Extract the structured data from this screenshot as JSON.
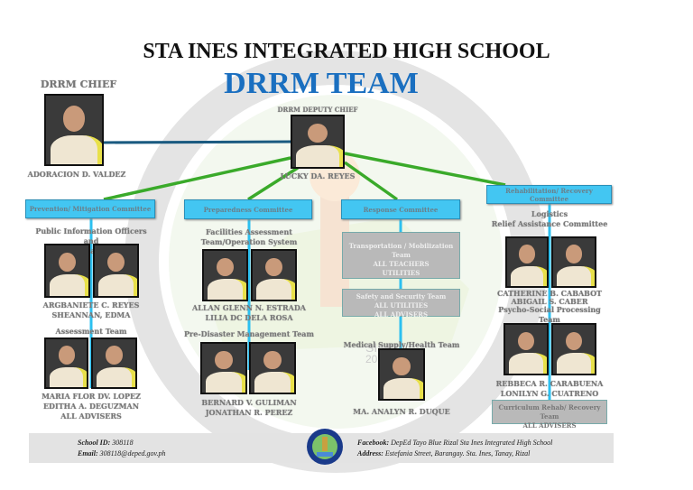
{
  "header": {
    "school": "STA INES INTEGRATED HIGH SCHOOL",
    "team": "DRRM TEAM"
  },
  "chief": {
    "label": "DRRM CHIEF",
    "name": "ADORACION D. VALDEZ"
  },
  "deputy": {
    "label": "DRRM DEPUTY CHIEF",
    "name": "LUCKY DA. REYES"
  },
  "committees": {
    "prevention": {
      "label": "Prevention/ Mitigation Committee",
      "team1": {
        "title1": "Public Information Officers and",
        "title2": "Communication Team",
        "name1": "ARGBANIETE C. REYES",
        "name2": "SHEANNAN, EDMA"
      },
      "team2": {
        "title": "Assessment Team",
        "name1": "MARIA FLOR DV. LOPEZ",
        "name2": "EDITHA A. DEGUZMAN",
        "name3": "ALL ADVISERS"
      }
    },
    "preparedness": {
      "label": "Preparedness Committee",
      "team1": {
        "title1": "Facilities Assessment",
        "title2": "Team/Operation System",
        "name1": "ALLAN GLENN N. ESTRADA",
        "name2": "LILIA DC DELA ROSA"
      },
      "team2": {
        "title": "Pre-Disaster Management Team",
        "name1": "BERNARD V. GULIMAN",
        "name2": "JONATHAN R. PEREZ"
      }
    },
    "response": {
      "label": "Response Committee",
      "team1": {
        "title": "Transportation / Mobilization Team",
        "line1": "ALL TEACHERS",
        "line2": "UTILITIES"
      },
      "team2": {
        "title": "Safety and Security Team",
        "line1": "ALL UTILITIES",
        "line2": "ALL ADVISERS"
      },
      "team3": {
        "title": "Medical Supply/Health Team",
        "name1": "MA. ANALYN R. DUQUE"
      }
    },
    "rehab": {
      "label": "Rehabilitation/ Recovery Committee",
      "team1": {
        "title1": "Logistics",
        "title2": "Relief Assistance Committee",
        "name1": "CATHERINE B. CABABOT",
        "name2": "ABIGAIL S. CABER"
      },
      "team2": {
        "title": "Psycho-Social Processing Team",
        "name1": "REBBECA R. CARABUENA",
        "name2": "LONILYN G. CUATRENO"
      },
      "team3": {
        "title": "Curriculum Rehab/ Recovery Team",
        "line1": "ALL ADVISERS"
      }
    }
  },
  "watermark": {
    "text1": "SIIHS",
    "text2": "2022"
  },
  "footer": {
    "id_label": "School ID:",
    "id": "308118",
    "email_label": "Email:",
    "email": "308118@deped.gov.ph",
    "fb_label": "Facebook:",
    "fb": "DepEd Tayo Blue Rizal Sta Ines Integrated High School",
    "addr_label": "Address:",
    "addr": "Estefania Street, Barangay. Sta. Ines, Tanay, Rizal"
  },
  "colors": {
    "title_blue": "#1a6fc0",
    "box_cyan": "#43c6f2",
    "line_green": "#3aaa2a",
    "line_navy": "#1a5a80"
  }
}
